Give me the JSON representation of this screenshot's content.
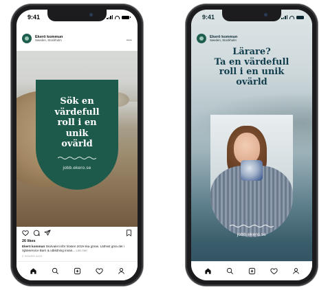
{
  "left_phone": {
    "status_time": "9:41",
    "account_name": "Ekerö kommun",
    "account_location": "Sweden, Stockholm",
    "more_menu": "...",
    "ad": {
      "headline_lines": [
        "Sök en",
        "värdefull",
        "roll i en unik",
        "ovärld"
      ],
      "url": "jobb.ekero.se",
      "panel_color": "#1e5a4c"
    },
    "likes": "26 likes",
    "caption_author": "Ekerö kommun",
    "caption_text": " Skolvalet inför hösten 2019 ska göras. Läthsst göra det i Självservice Barn & utbildning innan...",
    "caption_more": "Läs mer",
    "posted_ago": "2 HOURS AGO",
    "icons": [
      "heart-icon",
      "comment-icon",
      "share-icon",
      "bookmark-icon"
    ]
  },
  "right_phone": {
    "status_time": "9:41",
    "account_name": "Ekerö kommun",
    "account_location": "Sweden, Stockholm",
    "story": {
      "headline_lines": [
        "Lärare?",
        "Ta en värdefull",
        "roll i en unik",
        "ovärld"
      ],
      "url": "jobb.ekero.se",
      "headline_color": "#123d4c"
    }
  },
  "bottom_nav": [
    "home-icon",
    "search-icon",
    "add-post-icon",
    "activity-icon",
    "profile-icon"
  ]
}
